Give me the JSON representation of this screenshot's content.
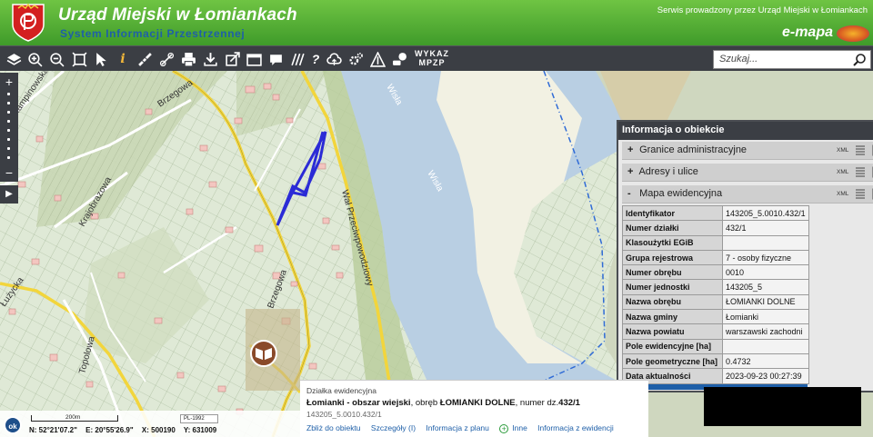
{
  "header": {
    "title": "Urząd Miejski w Łomiankach",
    "subtitle": "System Informacji Przestrzennej",
    "service_text": "Serwis prowadzony przez Urząd Miejski w Łomiankach",
    "brand": "e-mapa"
  },
  "toolbar": {
    "icons": [
      "layers-icon",
      "zoom-in-icon",
      "zoom-out-icon",
      "zoom-extent-icon",
      "select-arrow-icon",
      "info-icon",
      "measure-icon",
      "link-icon",
      "print-icon",
      "download-icon",
      "export-icon",
      "window-icon",
      "comment-icon",
      "hatch-icon",
      "help-icon",
      "cloud-upload-icon",
      "settings-icon",
      "route-icon",
      "annotation-icon"
    ],
    "wykaz_line1": "WYKAZ",
    "wykaz_line2": "MPZP",
    "search_placeholder": "Szukaj..."
  },
  "map": {
    "street_labels": [
      "Brzegowa",
      "Brzegowa",
      "Kampinowska",
      "Krajobrazowa",
      "Łużycka",
      "Topolowa",
      "Wał Przeciwpowodziowy",
      "Wisła",
      "Wisła"
    ],
    "accent_colors": {
      "road": "#f2d53c",
      "parcel": "#2b2bd6",
      "water": "#b9cfe3",
      "sand": "#f2f1e3",
      "boundary": "#2f6bd6"
    }
  },
  "panel": {
    "title": "Informacja o obiekcie",
    "sections": [
      {
        "sign": "+",
        "label": "Granice administracyjne",
        "xml": "XML"
      },
      {
        "sign": "+",
        "label": "Adresy i ulice",
        "xml": "XML"
      },
      {
        "sign": "-",
        "label": "Mapa ewidencyjna",
        "xml": "XML"
      }
    ],
    "rows": [
      {
        "k": "Identyfikator",
        "v": "143205_5.0010.432/1"
      },
      {
        "k": "Numer działki",
        "v": "432/1"
      },
      {
        "k": "Klasoużytki EGiB",
        "v": ""
      },
      {
        "k": "Grupa rejestrowa",
        "v": "7 - osoby fizyczne"
      },
      {
        "k": "Numer obrębu",
        "v": "0010"
      },
      {
        "k": "Numer jednostki",
        "v": "143205_5"
      },
      {
        "k": "Nazwa obrębu",
        "v": "ŁOMIANKI DOLNE"
      },
      {
        "k": "Nazwa gminy",
        "v": "Łomianki"
      },
      {
        "k": "Nazwa powiatu",
        "v": "warszawski zachodni"
      },
      {
        "k": "Pole ewidencyjne [ha]",
        "v": ""
      },
      {
        "k": "Pole geometryczne [ha]",
        "v": "0.4732"
      },
      {
        "k": "Data aktualności",
        "v": "2023-09-23 00:27:39"
      }
    ]
  },
  "bottom": {
    "ok": "ok",
    "scale": "200m",
    "crs": "PL-1992",
    "coord_n": "N: 52°21'07.2\"",
    "coord_e": "E: 20°55'26.9\"",
    "coord_x": "X: 500190",
    "coord_y": "Y: 631009"
  },
  "parcel": {
    "type": "Działka ewidencyjna",
    "name_bold": "Łomianki - obszar wiejski",
    "mid1": ", obręb ",
    "obreb": "ŁOMIANKI DOLNE",
    "mid2": ", numer dz.",
    "numer": "432/1",
    "id": "143205_5.0010.432/1",
    "actions": [
      "Zbliż do obiektu",
      "Szczegóły (I)",
      "Informacja z planu",
      "Inne",
      "Informacja z ewidencji"
    ]
  }
}
